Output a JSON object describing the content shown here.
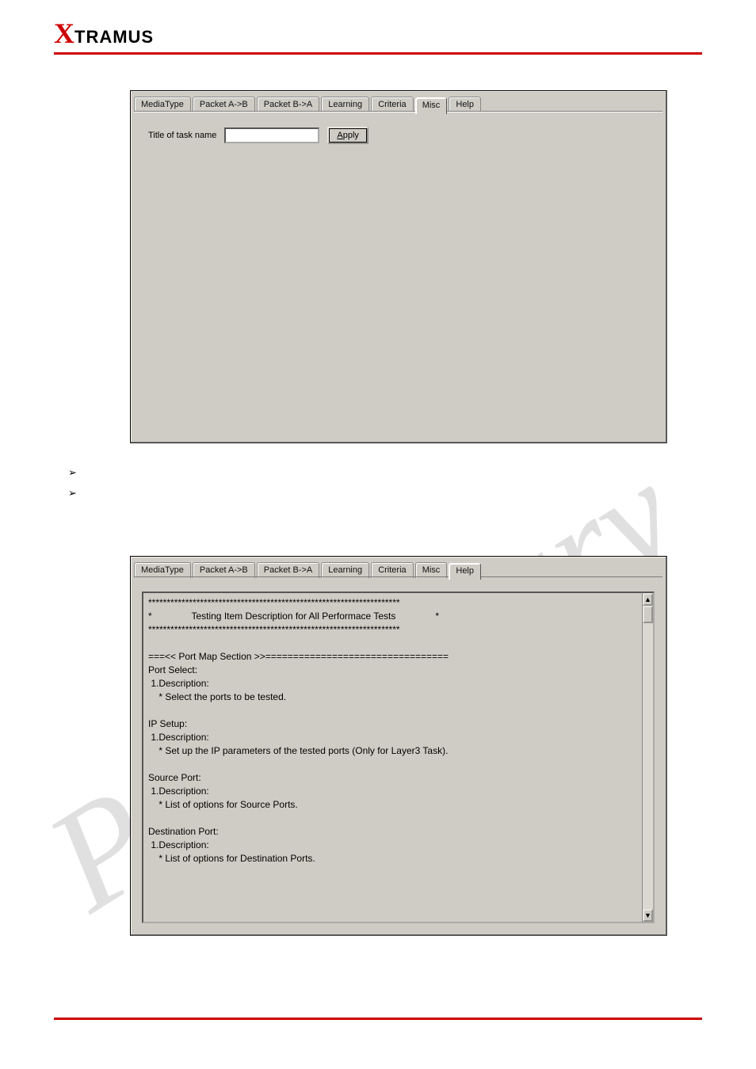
{
  "logo": {
    "x": "X",
    "rest": "TRAMUS"
  },
  "panel1": {
    "tabs": [
      {
        "label": "MediaType"
      },
      {
        "label": "Packet A->B"
      },
      {
        "label": "Packet B->A"
      },
      {
        "label": "Learning"
      },
      {
        "label": "Criteria"
      },
      {
        "label": "Misc",
        "active": true
      },
      {
        "label": "Help"
      }
    ],
    "field_label": "Title of task name",
    "field_value": "",
    "apply_btn_prefix": "A",
    "apply_btn_rest": "pply"
  },
  "bullets": {
    "b1": "➢",
    "b2": "➢"
  },
  "panel2": {
    "tabs": [
      {
        "label": "MediaType"
      },
      {
        "label": "Packet A->B"
      },
      {
        "label": "Packet B->A"
      },
      {
        "label": "Learning"
      },
      {
        "label": "Criteria"
      },
      {
        "label": "Misc"
      },
      {
        "label": "Help",
        "active": true
      }
    ],
    "help_text": "********************************************************************\n*               Testing Item Description for All Performace Tests               *\n********************************************************************\n\n===<< Port Map Section >>=================================\nPort Select:\n 1.Description:\n    * Select the ports to be tested.\n\nIP Setup:\n 1.Description:\n    * Set up the IP parameters of the tested ports (Only for Layer3 Task).\n\nSource Port:\n 1.Description:\n    * List of options for Source Ports.\n\nDestination Port:\n 1.Description:\n    * List of options for Destination Ports."
  },
  "scroll_arrows": {
    "up": "▲",
    "down": "▼"
  }
}
